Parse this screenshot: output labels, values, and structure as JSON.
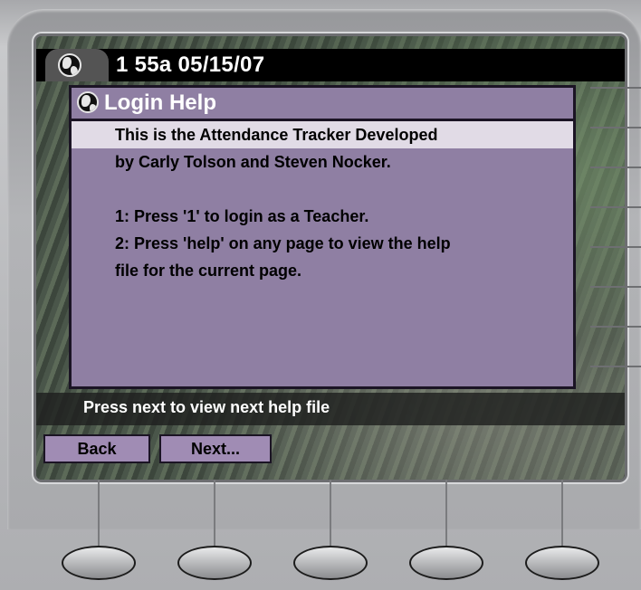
{
  "header": {
    "clock_text": "1 55a 05/15/07"
  },
  "panel": {
    "title": "Login Help",
    "lines": [
      "This is the Attendance Tracker Developed",
      "by Carly Tolson and Steven Nocker.",
      "",
      "1: Press '1' to login as a Teacher.",
      "2: Press 'help' on any page to view the help",
      "file for the current page."
    ],
    "selected_line_index": 0
  },
  "status": {
    "text": "Press next to view next help file"
  },
  "softkeys": {
    "back_label": "Back",
    "next_label": "Next..."
  },
  "colors": {
    "panel": "#8f7fa3",
    "selected_line": "#e1dbe6",
    "softkey": "#a08cb4",
    "header": "#000000"
  },
  "icons": {
    "header_icon": "globe-icon",
    "title_icon": "globe-icon"
  }
}
